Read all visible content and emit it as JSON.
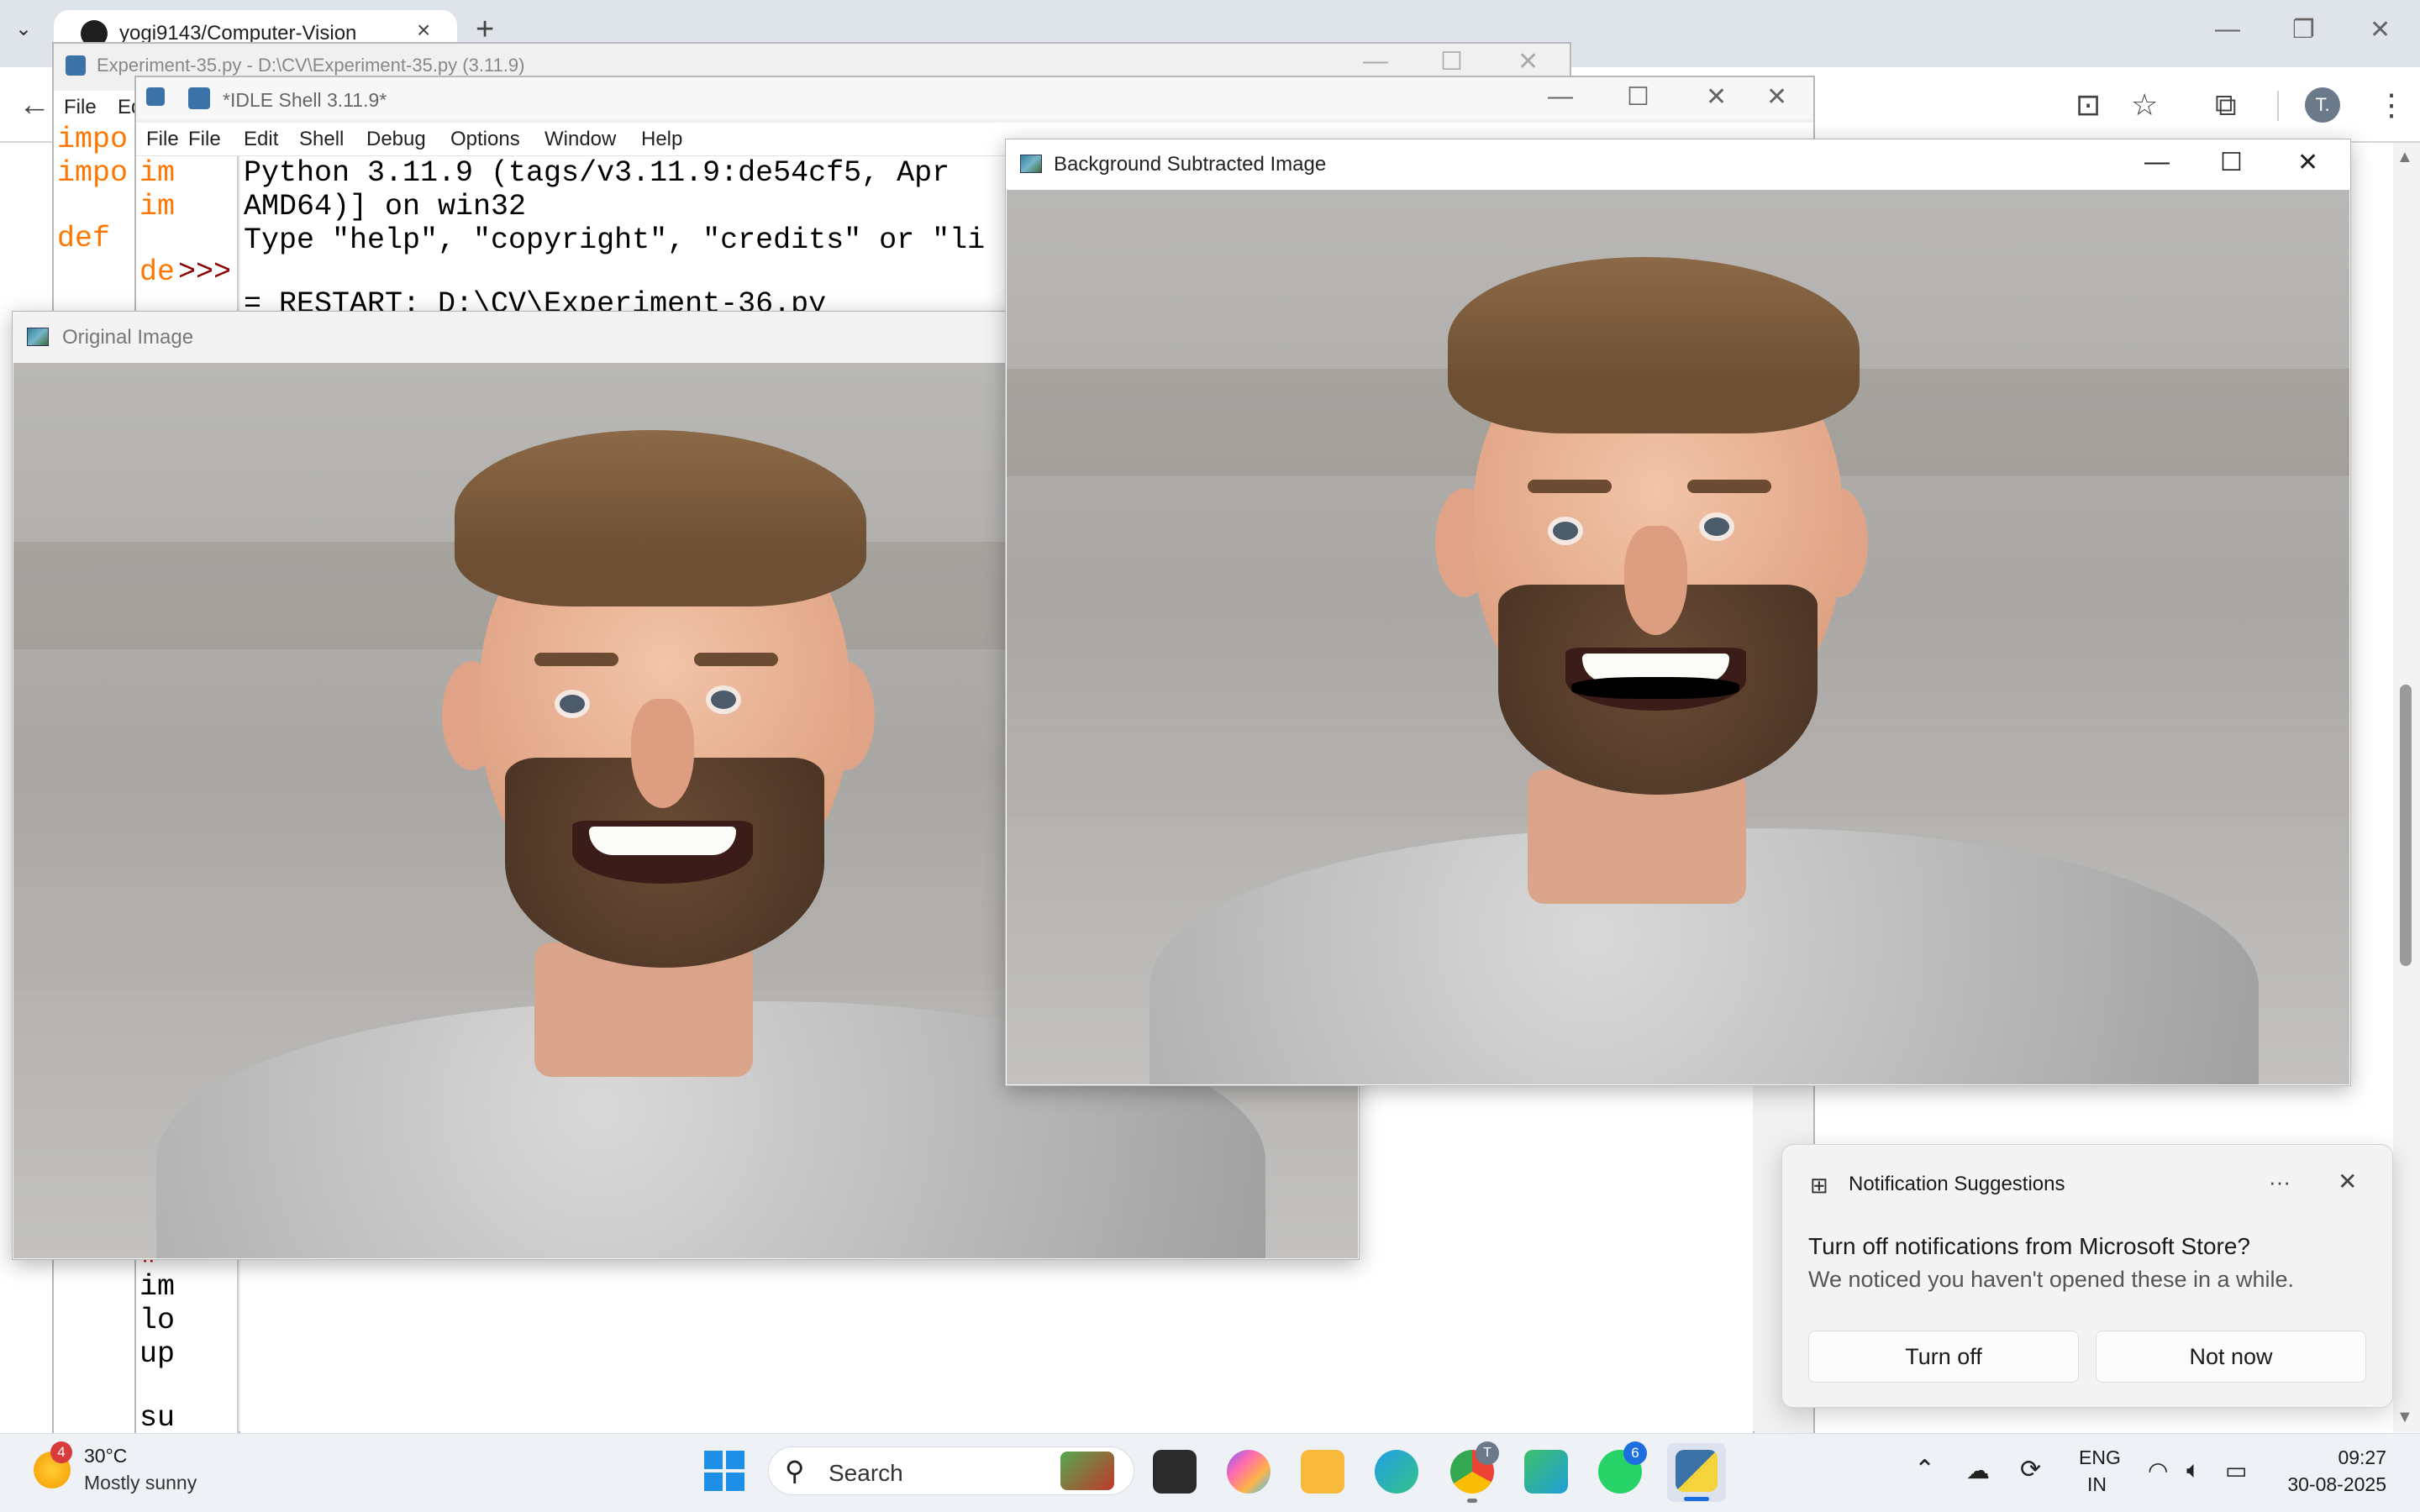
{
  "browser": {
    "tab_title": "yogi9143/Computer-Vision",
    "profile_initial": "T."
  },
  "editor35": {
    "title": "Experiment-35.py - D:\\CV\\Experiment-35.py (3.11.9)",
    "menu_file": "File",
    "menu_edit": "Ed",
    "code_lines": [
      "impo",
      "impo",
      "def "
    ],
    "red_line_start": "de"
  },
  "shell": {
    "title": "*IDLE Shell 3.11.9*",
    "menu": {
      "file_left": "File",
      "file": "File",
      "edit": "Edit",
      "shell": "Shell",
      "debug": "Debug",
      "options": "Options",
      "window": "Window",
      "help": "Help"
    },
    "gutter_top": [
      "im",
      "im"
    ],
    "prompt": ">>>",
    "output_lines": [
      "Python 3.11.9 (tags/v3.11.9:de54cf5, Apr",
      "AMD64)] on win32",
      "Type \"help\", \"copyright\", \"credits\" or \"li"
    ],
    "restart_line": "= RESTART: D:\\CV\\Experiment-36.py",
    "bottom_gutter": [
      "\"",
      "im",
      "lo",
      "up",
      "",
      "su"
    ]
  },
  "original_window": {
    "title": "Original Image"
  },
  "bgsub_window": {
    "title": "Background Subtracted Image"
  },
  "notification": {
    "header": "Notification Suggestions",
    "more": "···",
    "title": "Turn off notifications from Microsoft Store?",
    "body": "We noticed you haven't opened these in a while.",
    "primary_button": "Turn off",
    "secondary_button": "Not now"
  },
  "taskbar": {
    "weather_badge": "4",
    "temperature": "30°C",
    "weather_desc": "Mostly sunny",
    "search_placeholder": "Search",
    "chrome_badge": "T",
    "whatsapp_badge": "6",
    "language_top": "ENG",
    "language_bottom": "IN",
    "time": "09:27",
    "date": "30-08-2025"
  },
  "colors": {
    "idle_orange": "#ff7700",
    "idle_red": "#c00000",
    "notif_bg": "#f3f3f3",
    "taskbar_bg": "#eef1f6"
  }
}
